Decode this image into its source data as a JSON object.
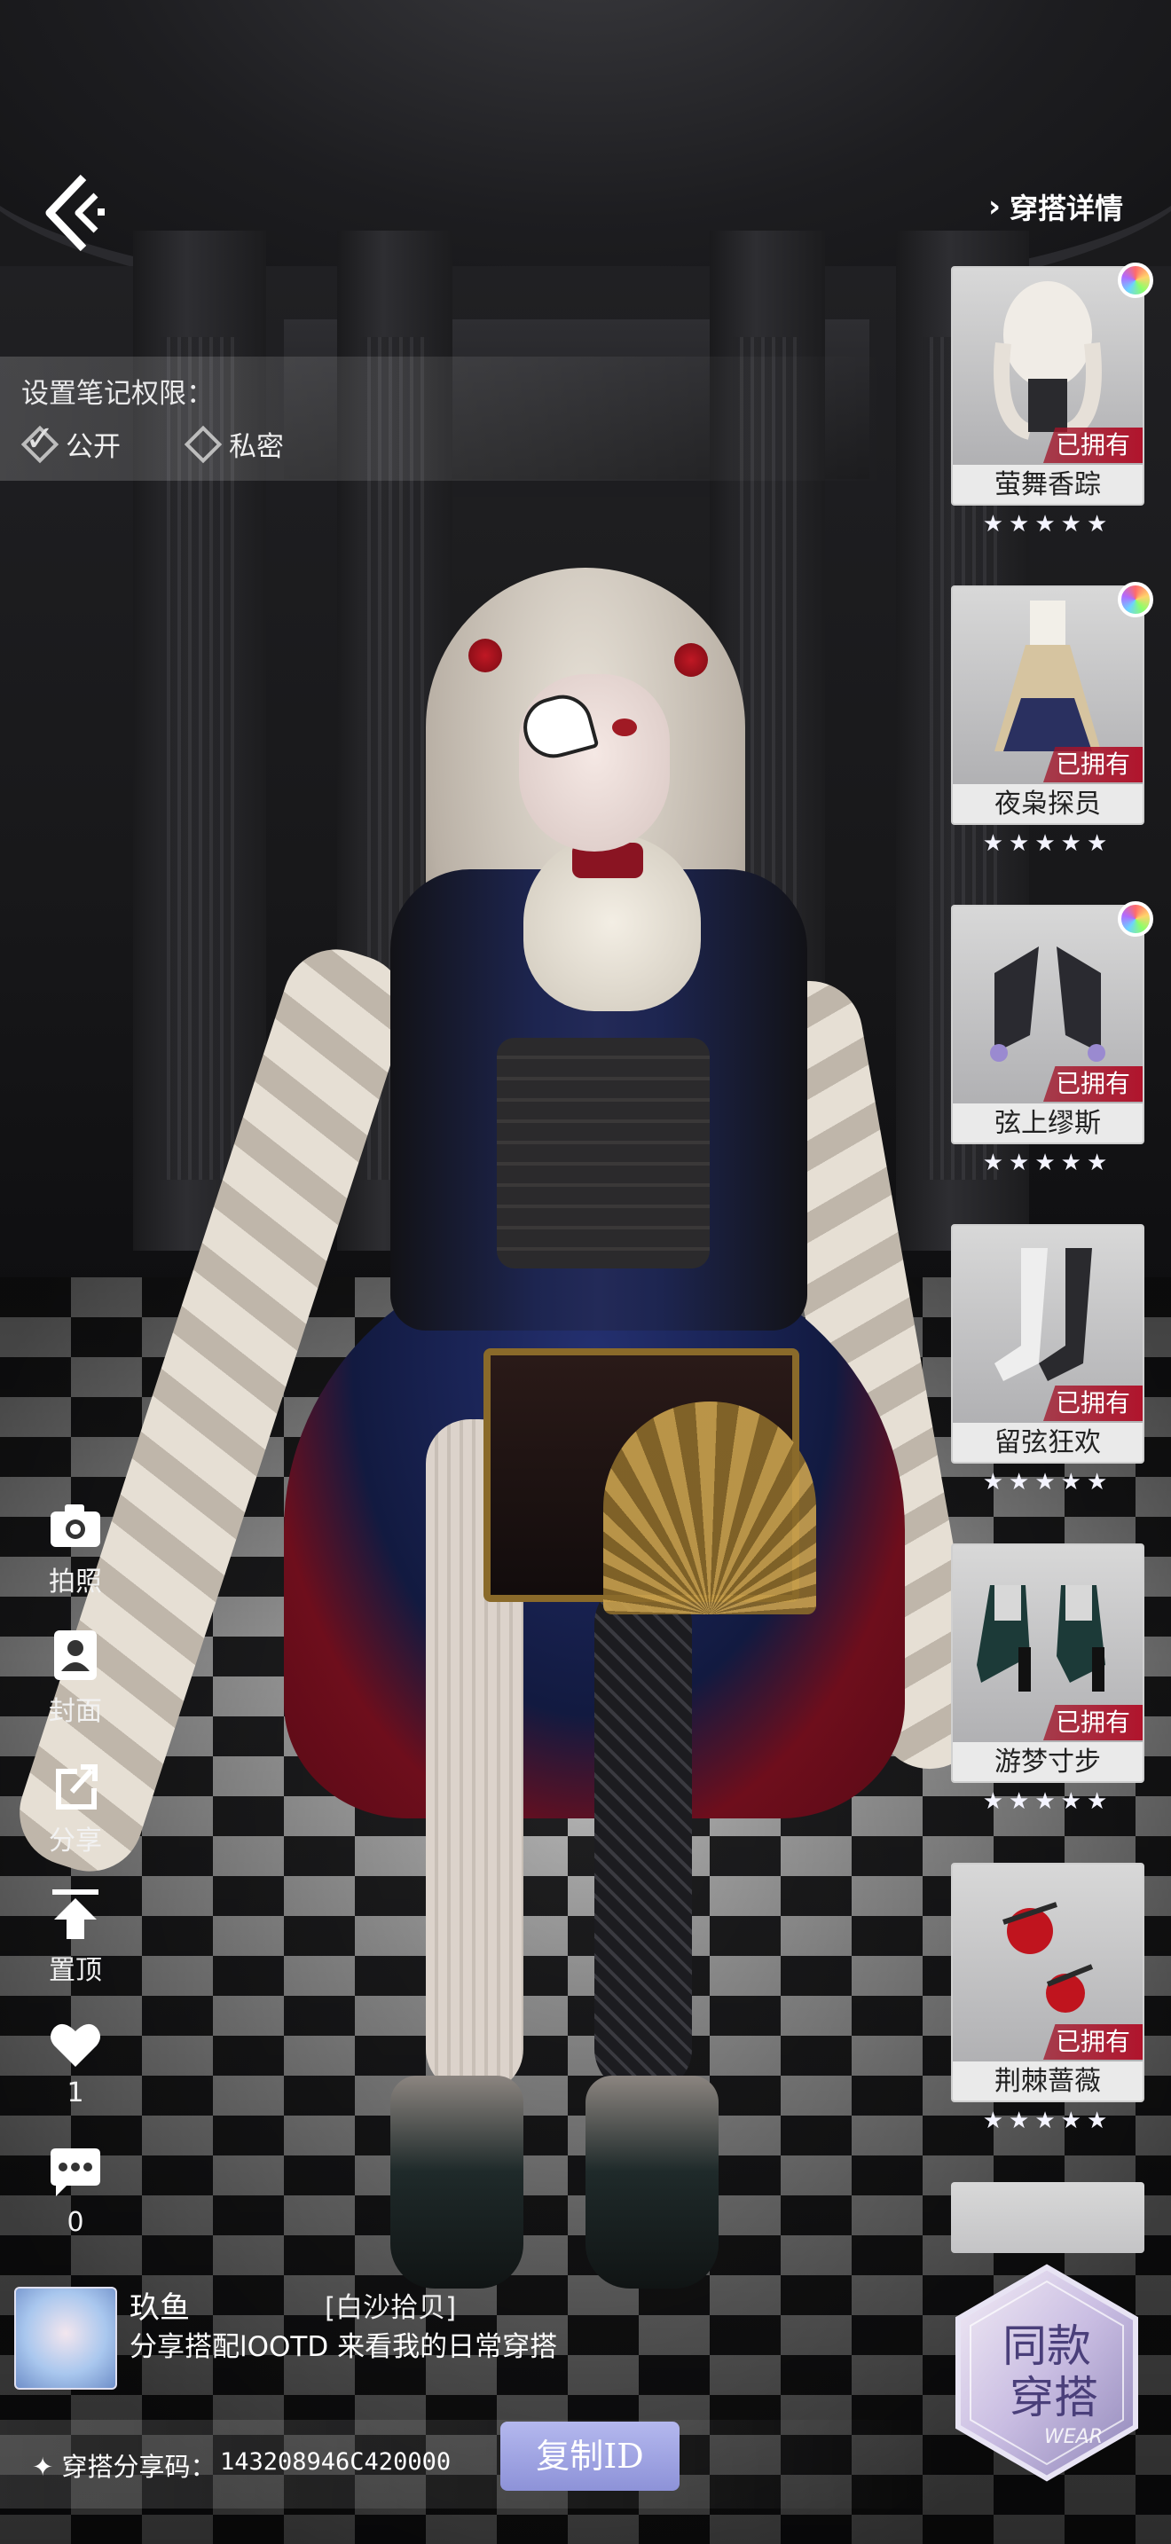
{
  "header": {
    "details_label": "穿搭详情"
  },
  "permission": {
    "title": "设置笔记权限：",
    "options": [
      {
        "label": "公开",
        "checked": true
      },
      {
        "label": "私密",
        "checked": false
      }
    ]
  },
  "items": [
    {
      "name": "萤舞香踪",
      "status": "已拥有",
      "stars": "★★★★★",
      "icon": "hair-icon",
      "rainbow": true
    },
    {
      "name": "夜枭探员",
      "status": "已拥有",
      "stars": "★★★★★",
      "icon": "dress-icon",
      "rainbow": true
    },
    {
      "name": "弦上缪斯",
      "status": "已拥有",
      "stars": "★★★★★",
      "icon": "gloves-icon",
      "rainbow": true
    },
    {
      "name": "留弦狂欢",
      "status": "已拥有",
      "stars": "★★★★★",
      "icon": "stockings-icon",
      "rainbow": false
    },
    {
      "name": "游梦寸步",
      "status": "已拥有",
      "stars": "★★★★★",
      "icon": "shoes-icon",
      "rainbow": false
    },
    {
      "name": "荆棘蔷薇",
      "status": "已拥有",
      "stars": "★★★★★",
      "icon": "rose-accessory-icon",
      "rainbow": false
    }
  ],
  "actions": [
    {
      "label": "拍照",
      "icon": "camera-icon"
    },
    {
      "label": "封面",
      "icon": "cover-portrait-icon"
    },
    {
      "label": "分享",
      "icon": "share-icon"
    },
    {
      "label": "置顶",
      "icon": "pin-top-icon"
    },
    {
      "label": "1",
      "icon": "heart-icon"
    },
    {
      "label": "0",
      "icon": "comment-icon"
    }
  ],
  "post": {
    "username": "玖鱼",
    "tag": "[白沙拾贝]",
    "description": "分享搭配lOOTD 来看我的日常穿搭"
  },
  "share": {
    "label": "✦ 穿搭分享码：",
    "code": "143208946C420000",
    "copy_button": "复制ID"
  },
  "same_outfit": {
    "line1": "同款",
    "line2": "穿搭",
    "watermark": "WEAR"
  },
  "colors": {
    "owned_badge": "#b0142c",
    "copy_button": "#9da1e2",
    "name_bar": "#eaeaea"
  }
}
